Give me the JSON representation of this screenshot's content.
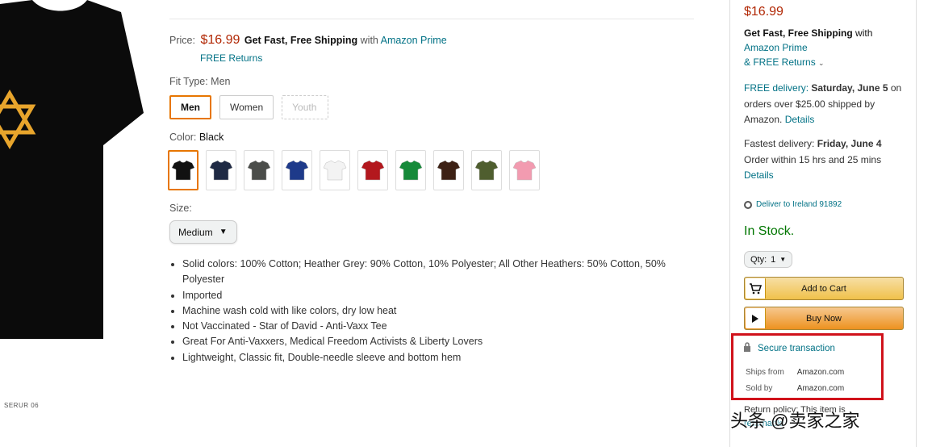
{
  "product": {
    "image_caption": "SERUR 06"
  },
  "price_row": {
    "label": "Price:",
    "amount": "$16.99",
    "shipping": "Get Fast, Free Shipping",
    "with_text": "with",
    "prime_link": "Amazon Prime",
    "returns": "FREE Returns"
  },
  "fit": {
    "label": "Fit Type: Men",
    "options": [
      "Men",
      "Women",
      "Youth"
    ]
  },
  "color": {
    "label": "Color:",
    "selected": "Black",
    "swatches": [
      "#111111",
      "#1f2a44",
      "#4b4d4a",
      "#1e3a8a",
      "#f3f3f3",
      "#b3181e",
      "#168a3a",
      "#3d2115",
      "#4f5e2f",
      "#f29bb0"
    ]
  },
  "size": {
    "label": "Size:",
    "selected": "Medium"
  },
  "bullets": [
    "Solid colors: 100% Cotton; Heather Grey: 90% Cotton, 10% Polyester; All Other Heathers: 50% Cotton, 50% Polyester",
    "Imported",
    "Machine wash cold with like colors, dry low heat",
    "Not Vaccinated - Star of David - Anti-Vaxx Tee",
    "Great For Anti-Vaxxers, Medical Freedom Activists & Liberty Lovers",
    "Lightweight, Classic fit, Double-needle sleeve and bottom hem"
  ],
  "buybox": {
    "price": "$16.99",
    "ship_bold": "Get Fast, Free Shipping",
    "ship_with": "with",
    "prime_link": "Amazon Prime",
    "returns_link": "& FREE Returns",
    "delivery_label": "FREE delivery:",
    "delivery_date": "Saturday, June 5",
    "delivery_rest": "on orders over $25.00 shipped by Amazon.",
    "details_link": "Details",
    "fastest_label": "Fastest delivery:",
    "fastest_date": "Friday, June 4",
    "fastest_order": "Order within 15 hrs and 25 mins",
    "fastest_details": "Details",
    "deliver_to": "Deliver to Ireland 91892",
    "stock": "In Stock.",
    "qty_label": "Qty:",
    "qty_value": "1",
    "add_to_cart": "Add to Cart",
    "buy_now": "Buy Now",
    "secure": "Secure transaction",
    "ships_from_label": "Ships from",
    "ships_from_value": "Amazon.com",
    "sold_by_label": "Sold by",
    "sold_by_value": "Amazon.com",
    "return_text": "Return policy: This item is",
    "return_link": "returnable"
  },
  "watermark": {
    "text": "头条 @卖家之家"
  }
}
